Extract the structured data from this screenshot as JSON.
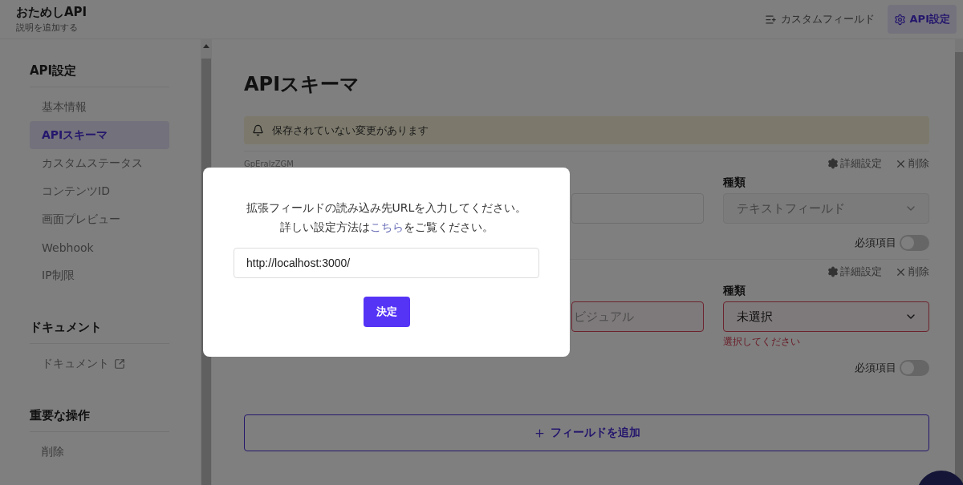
{
  "header": {
    "title": "おためしAPI",
    "description": "説明を追加する",
    "buttons": [
      {
        "label": "カスタムフィールド",
        "kind": "custom",
        "selected": false
      },
      {
        "label": "API設定",
        "kind": "settings",
        "selected": true
      }
    ]
  },
  "sidebar": {
    "sections": [
      {
        "title": "API設定",
        "items": [
          {
            "label": "基本情報",
            "kind": "link",
            "selected": false
          },
          {
            "label": "APIスキーマ",
            "kind": "link",
            "selected": true
          },
          {
            "label": "カスタムステータス",
            "kind": "link",
            "selected": false
          },
          {
            "label": "コンテンツID",
            "kind": "link",
            "selected": false
          },
          {
            "label": "画面プレビュー",
            "kind": "link",
            "selected": false
          },
          {
            "label": "Webhook",
            "kind": "link",
            "selected": false
          },
          {
            "label": "IP制限",
            "kind": "link",
            "selected": false
          }
        ]
      },
      {
        "title": "ドキュメント",
        "items": [
          {
            "label": "ドキュメント",
            "kind": "external",
            "selected": false
          }
        ]
      },
      {
        "title": "重要な操作",
        "items": [
          {
            "label": "削除",
            "kind": "link",
            "selected": false
          }
        ]
      }
    ]
  },
  "main": {
    "title": "APIスキーマ",
    "alert": "保存されていない変更があります",
    "fields": [
      {
        "id": "GpEralzZGM",
        "settings_label": "詳細設定",
        "delete_label": "削除",
        "type_label": "種類",
        "name_error": false,
        "type_value": "テキストフィールド",
        "type_disabled": true,
        "required_label": "必須項目",
        "required": false
      },
      {
        "settings_label": "詳細設定",
        "delete_label": "削除",
        "type_label": "種類",
        "name_placeholder": "ビジュアル",
        "name_error": true,
        "type_value": "未選択",
        "type_disabled": false,
        "type_error": "選択してください",
        "required_label": "必須項目",
        "required": false
      }
    ],
    "add_button": "フィールドを追加"
  },
  "modal": {
    "line_1": "拡張フィールドの読み込み先URLを入力してください。",
    "line_2_before": "詳しい設定方法は",
    "line_2_link": "こちら",
    "line_2_after": "をご覧ください。",
    "url_value": "http://localhost:3000/",
    "submit": "決定"
  }
}
